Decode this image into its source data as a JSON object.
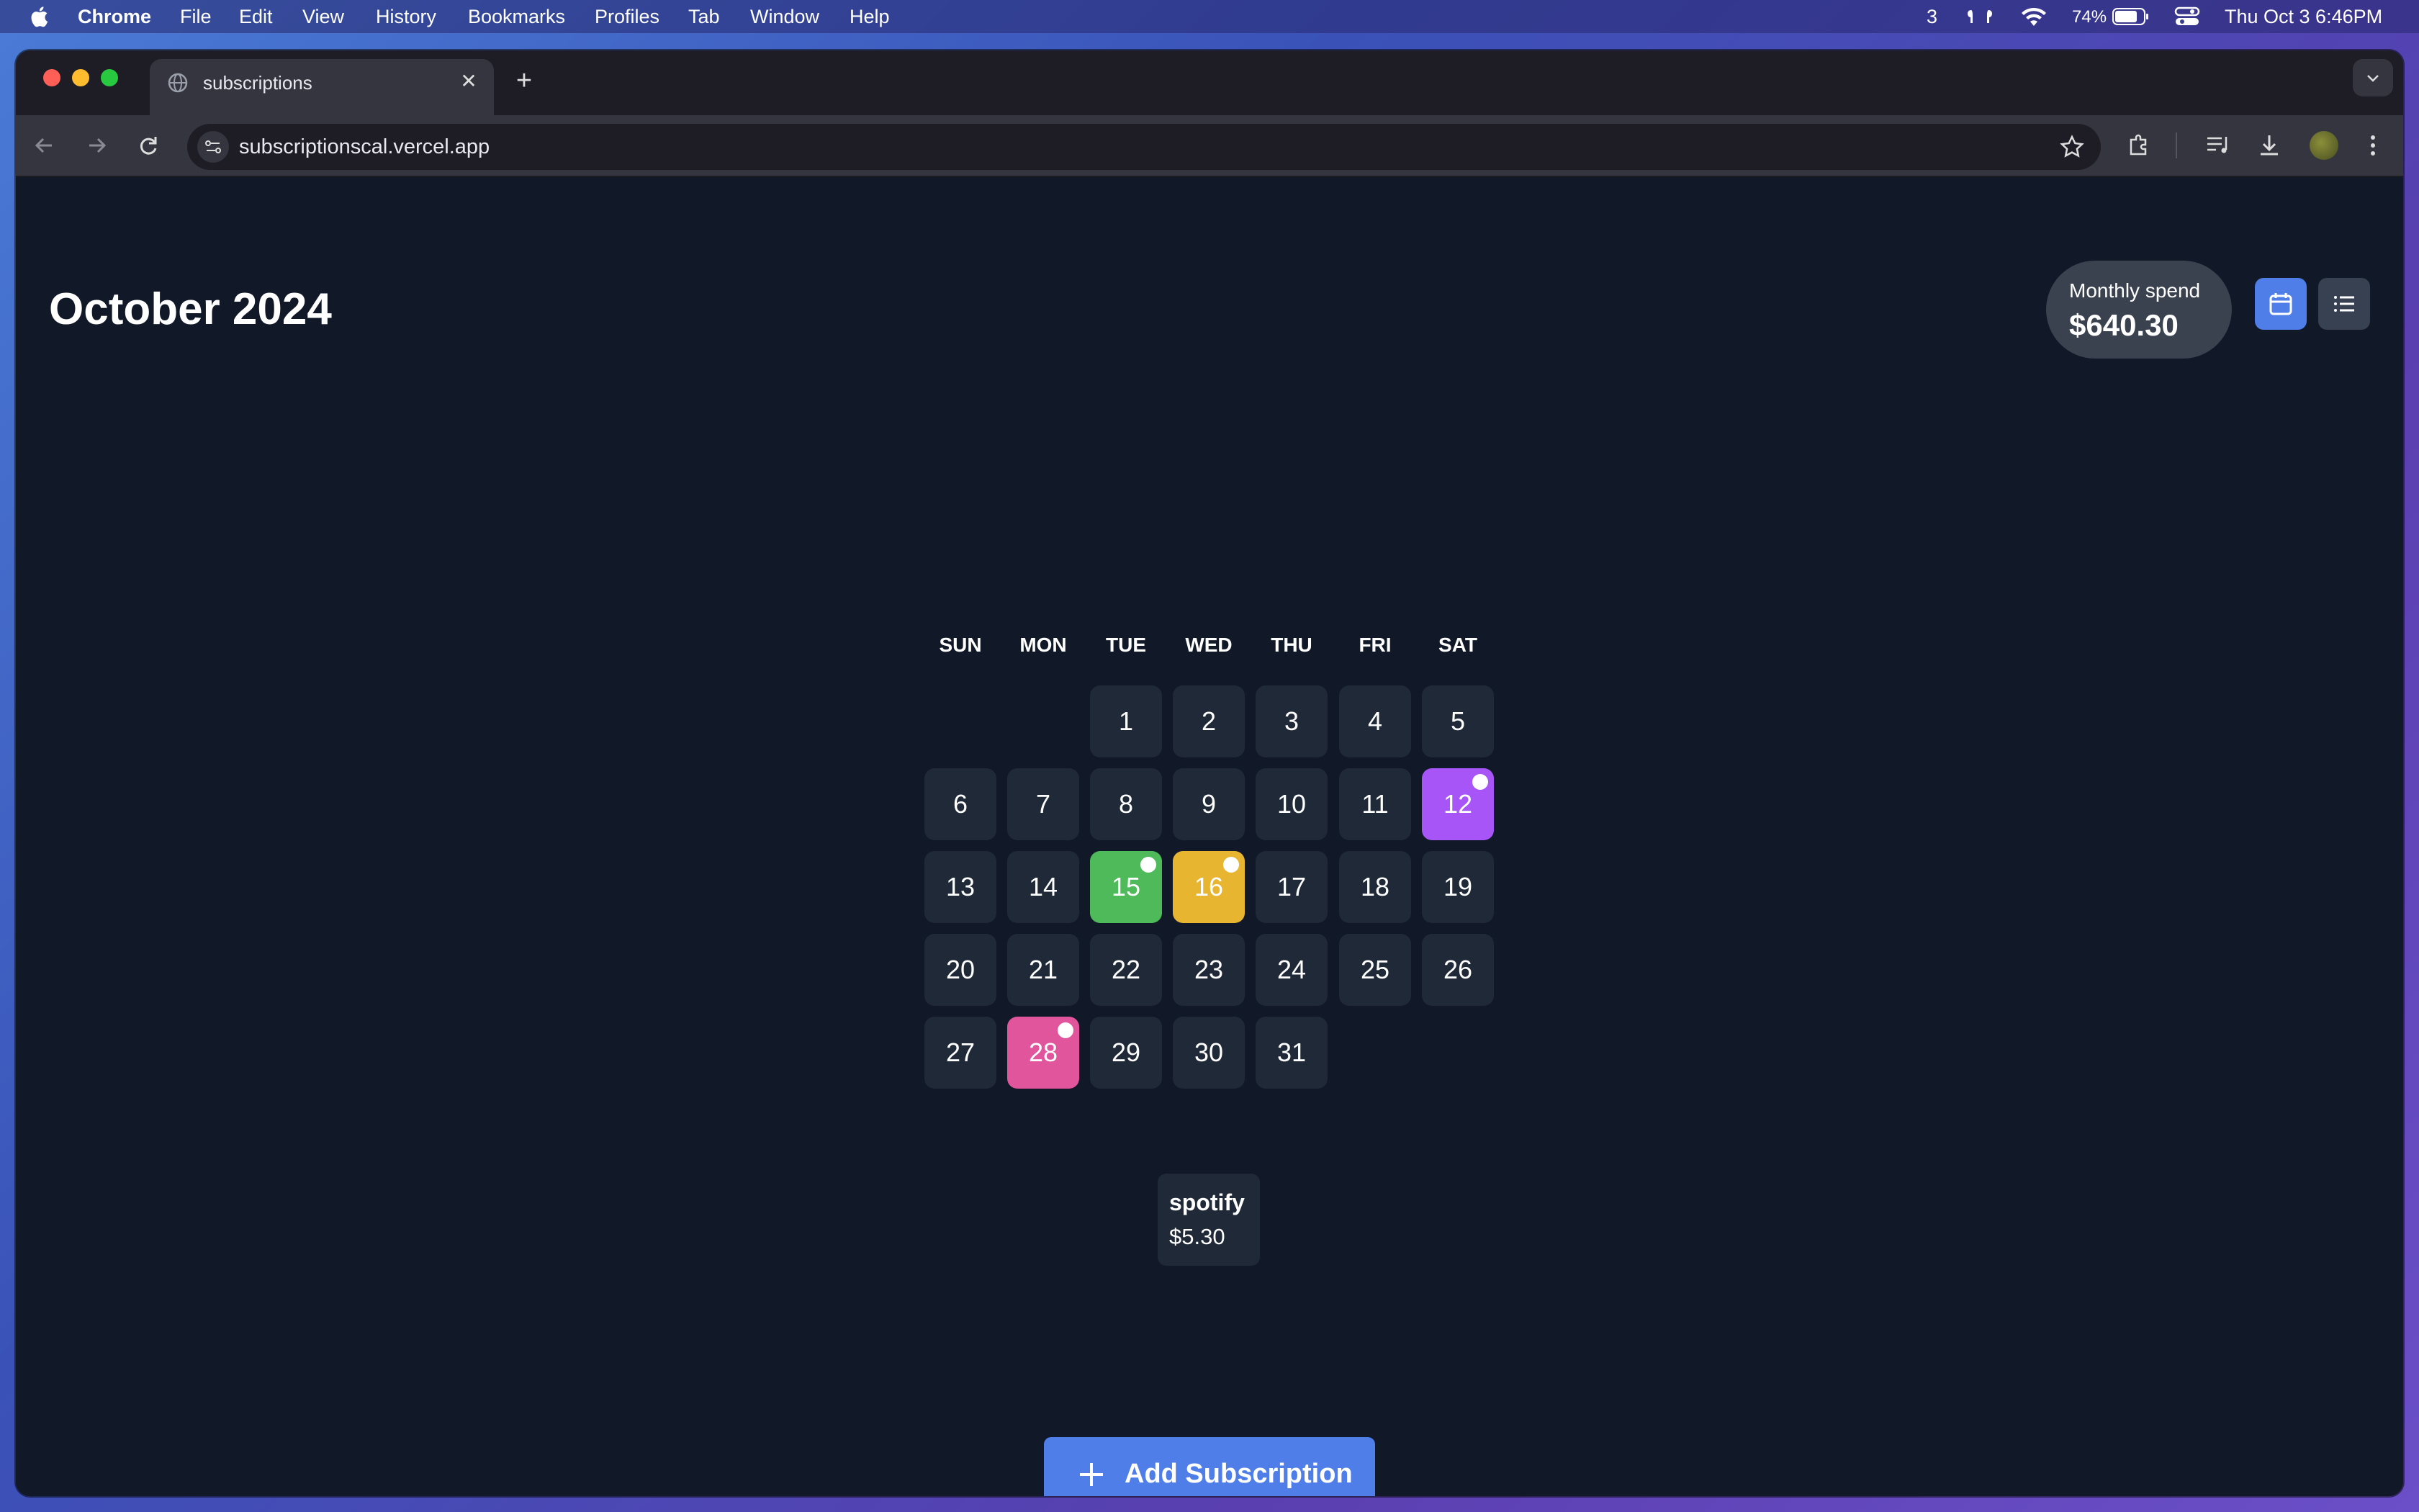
{
  "menubar": {
    "app_name": "Chrome",
    "items": [
      "File",
      "Edit",
      "View",
      "History",
      "Bookmarks",
      "Profiles",
      "Tab",
      "Window",
      "Help"
    ],
    "status": {
      "badge_count": "3",
      "battery": "74%",
      "datetime": "Thu Oct 3  6:46PM"
    }
  },
  "browser": {
    "tab_title": "subscriptions",
    "url": "subscriptionscal.vercel.app"
  },
  "page": {
    "month_title": "October 2024",
    "monthly_spend_label": "Monthly spend",
    "monthly_spend_value": "$640.30",
    "weekdays": [
      "SUN",
      "MON",
      "TUE",
      "WED",
      "THU",
      "FRI",
      "SAT"
    ],
    "days": [
      {
        "d": "1",
        "highlight": null
      },
      {
        "d": "2",
        "highlight": null
      },
      {
        "d": "3",
        "highlight": null
      },
      {
        "d": "4",
        "highlight": null
      },
      {
        "d": "5",
        "highlight": null
      },
      {
        "d": "6",
        "highlight": null
      },
      {
        "d": "7",
        "highlight": null
      },
      {
        "d": "8",
        "highlight": null
      },
      {
        "d": "9",
        "highlight": null
      },
      {
        "d": "10",
        "highlight": null
      },
      {
        "d": "11",
        "highlight": null
      },
      {
        "d": "12",
        "highlight": "#a855f7"
      },
      {
        "d": "13",
        "highlight": null
      },
      {
        "d": "14",
        "highlight": null
      },
      {
        "d": "15",
        "highlight": "#4fba5a"
      },
      {
        "d": "16",
        "highlight": "#e8b530"
      },
      {
        "d": "17",
        "highlight": null
      },
      {
        "d": "18",
        "highlight": null
      },
      {
        "d": "19",
        "highlight": null
      },
      {
        "d": "20",
        "highlight": null
      },
      {
        "d": "21",
        "highlight": null
      },
      {
        "d": "22",
        "highlight": null
      },
      {
        "d": "23",
        "highlight": null
      },
      {
        "d": "24",
        "highlight": null
      },
      {
        "d": "25",
        "highlight": null
      },
      {
        "d": "26",
        "highlight": null
      },
      {
        "d": "27",
        "highlight": null
      },
      {
        "d": "28",
        "highlight": "#e0559c"
      },
      {
        "d": "29",
        "highlight": null
      },
      {
        "d": "30",
        "highlight": null
      },
      {
        "d": "31",
        "highlight": null
      }
    ],
    "subscription_card": {
      "name": "spotify",
      "price": "$5.30"
    },
    "add_button_label": "Add Subscription"
  },
  "colors": {
    "accent": "#4f7ee8",
    "page_bg": "#111827",
    "cell_bg": "#1f2937"
  }
}
